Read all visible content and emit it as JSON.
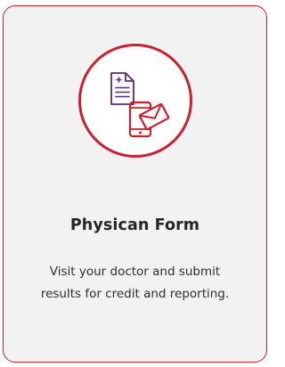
{
  "card": {
    "title": "Physican Form",
    "description": "Visit your doctor and submit results for credit and reporting."
  },
  "icons": {
    "badge": "document-and-phone-mail-icon",
    "document": "document-icon",
    "phone": "phone-icon",
    "envelope": "envelope-icon"
  },
  "colors": {
    "accent": "#c9202f",
    "document": "#5b2a6e",
    "card_background": "#f2f2f2"
  }
}
